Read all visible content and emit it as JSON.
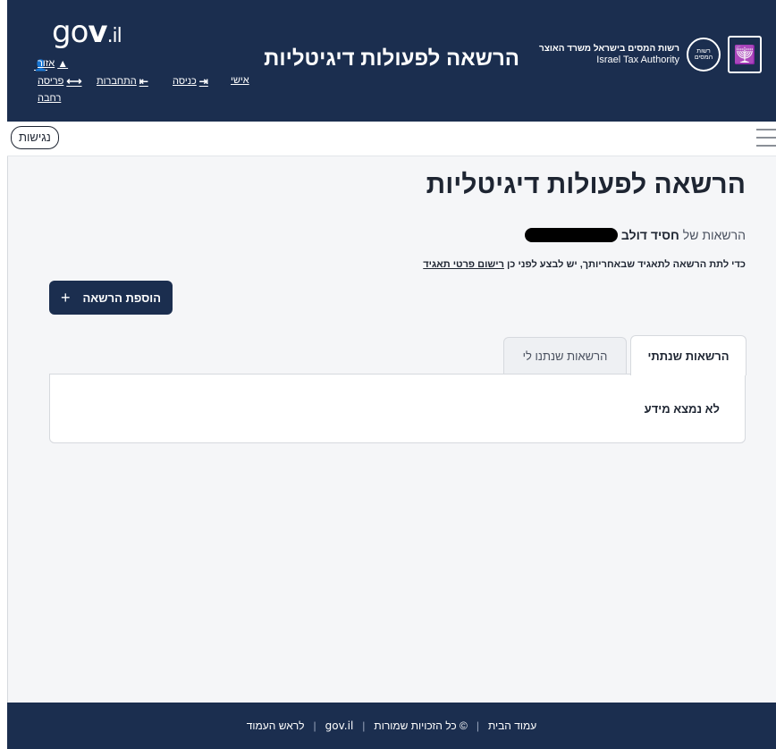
{
  "header": {
    "title": "הרשאה לפעולות דיגיטליות",
    "govil_logo": "gov.il",
    "authority_he": "רשות המסים בישראל משרד האוצר",
    "authority_en": "Israel Tax Authority",
    "emblem_icon": "menorah-emblem-icon",
    "links": {
      "personal_area_line1": "אזור",
      "personal_area_line2": "אישי",
      "login": "כניסה",
      "logout": "התחברות",
      "privacy": "פריסה",
      "privacy_line2": "רחבה"
    },
    "bg_color": "#1b2e4f"
  },
  "toolbar": {
    "accessibility_label": "נגישות"
  },
  "main": {
    "page_title": "הרשאה לפעולות דיגיטליות",
    "permissions_of_label": "הרשאות של",
    "person_name": "חסיד דולב",
    "info_text": "כדי לתת הרשאה לתאגיד שבאחריותך, יש לבצע לפני כן",
    "info_link": "רישום פרטי תאגיד",
    "add_button_label": "הוספת הרשאה",
    "add_button_icon": "+",
    "tabs": [
      {
        "label": "הרשאות שנתתי",
        "active": true
      },
      {
        "label": "הרשאות שנתנו לי",
        "active": false
      }
    ],
    "empty_message": "לא נמצא מידע"
  },
  "footer": {
    "home": "עמוד הבית",
    "rights": "© כל הזכויות שמורות",
    "govil": "gov.il",
    "top": "לראש העמוד",
    "separator": "|"
  }
}
